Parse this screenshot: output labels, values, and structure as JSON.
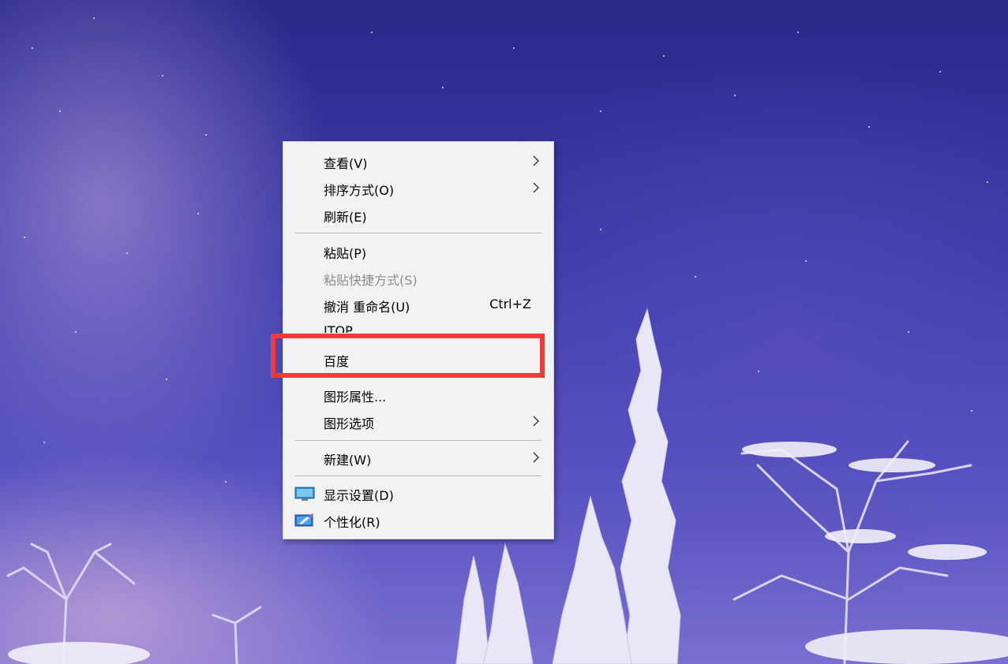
{
  "context_menu": {
    "items": [
      {
        "label": "查看(V)",
        "has_submenu": true
      },
      {
        "label": "排序方式(O)",
        "has_submenu": true
      },
      {
        "label": "刷新(E)"
      },
      {
        "label": "粘贴(P)"
      },
      {
        "label": "粘贴快捷方式(S)",
        "disabled": true
      },
      {
        "label": "撤消 重命名(U)",
        "shortcut": "Ctrl+Z"
      },
      {
        "label": "ITOP"
      },
      {
        "label": "百度"
      },
      {
        "label": "图形属性..."
      },
      {
        "label": "图形选项",
        "has_submenu": true
      },
      {
        "label": "新建(W)",
        "has_submenu": true
      },
      {
        "label": "显示设置(D)",
        "icon": "display-settings-icon"
      },
      {
        "label": "个性化(R)",
        "icon": "personalize-icon"
      }
    ]
  },
  "annotation": {
    "highlight_color": "#f23a3a",
    "highlighted_item": "百度"
  },
  "colors": {
    "menu_background": "#f2f2f2",
    "disabled_text": "#8d8d8d",
    "wallpaper_sky": "#3b3aa8"
  }
}
